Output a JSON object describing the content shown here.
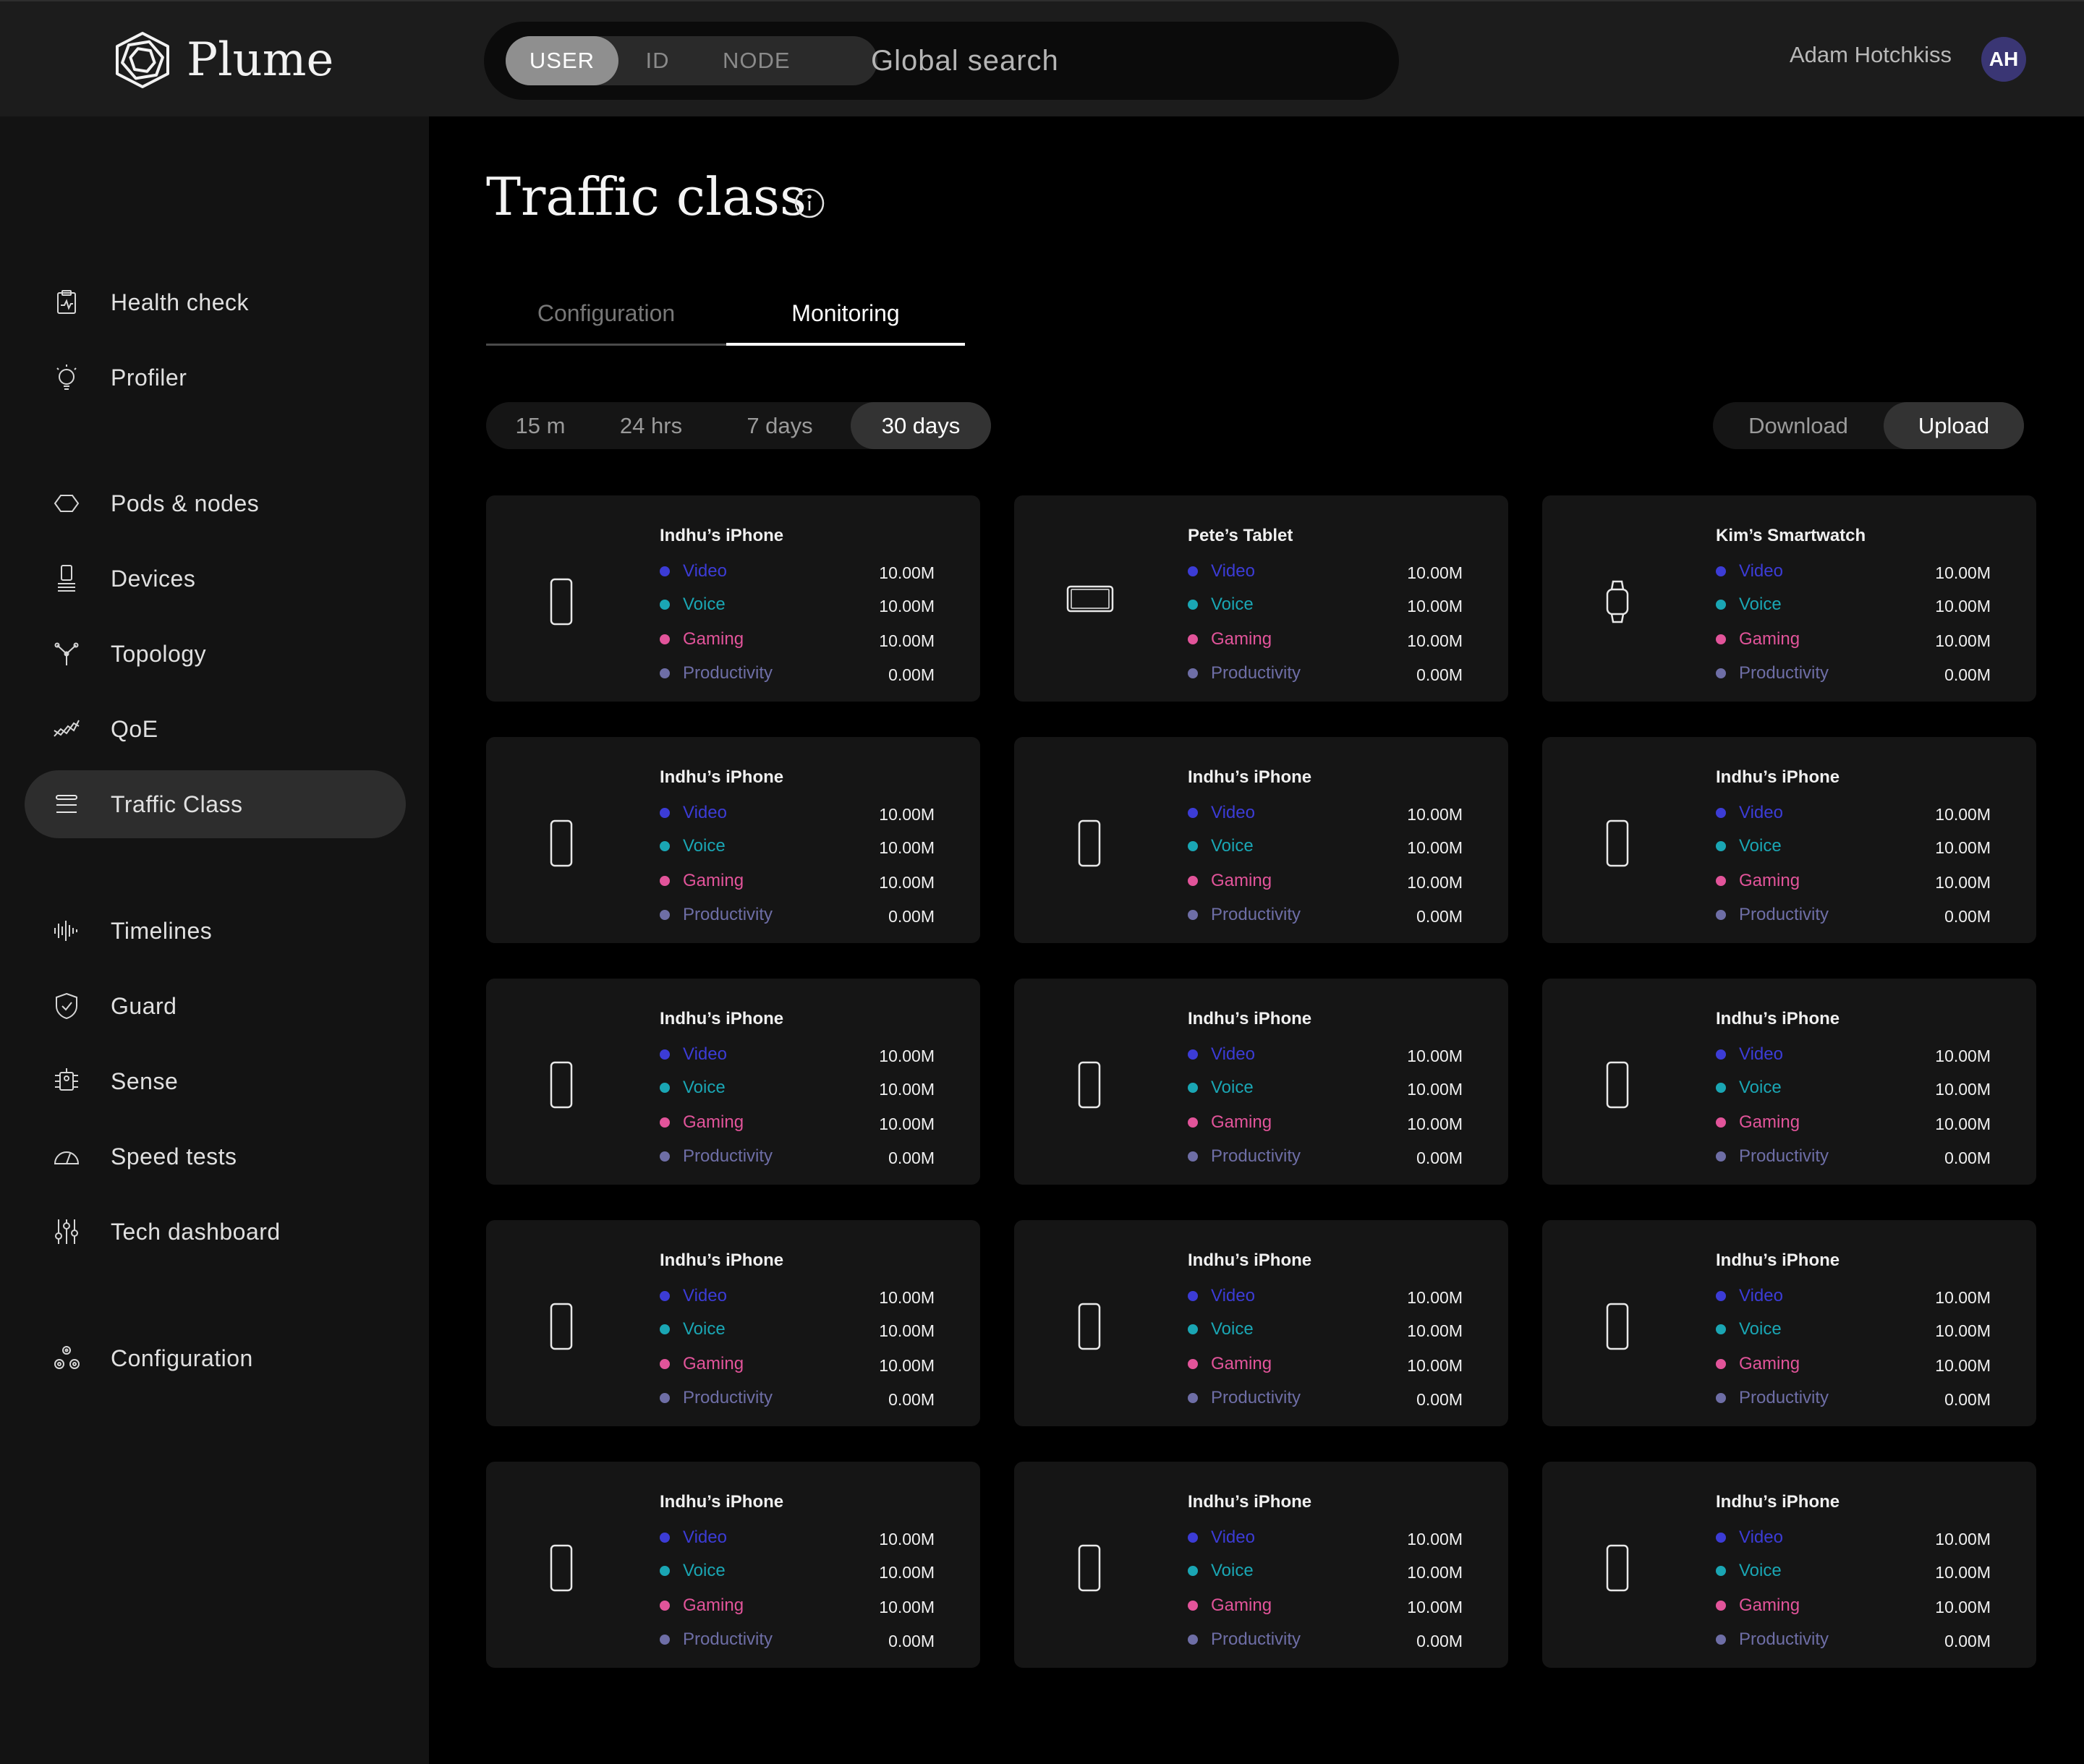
{
  "app": {
    "name": "Plume"
  },
  "search": {
    "modes": [
      "USER",
      "ID",
      "NODE"
    ],
    "active_mode": "USER",
    "placeholder": "Global search"
  },
  "user": {
    "name": "Adam Hotchkiss",
    "initials": "AH"
  },
  "sidebar": {
    "items": [
      {
        "label": "Health check",
        "icon": "clipboard-pulse-icon",
        "active": false
      },
      {
        "label": "Profiler",
        "icon": "lightbulb-icon",
        "active": false
      },
      {
        "label": "Pods & nodes",
        "icon": "hexagon-icon",
        "active": false
      },
      {
        "label": "Devices",
        "icon": "devices-icon",
        "active": false
      },
      {
        "label": "Topology",
        "icon": "topology-icon",
        "active": false
      },
      {
        "label": "QoE",
        "icon": "trend-icon",
        "active": false
      },
      {
        "label": "Traffic Class",
        "icon": "list-icon",
        "active": true
      },
      {
        "label": "Timelines",
        "icon": "waveform-icon",
        "active": false
      },
      {
        "label": "Guard",
        "icon": "shield-icon",
        "active": false
      },
      {
        "label": "Sense",
        "icon": "chip-icon",
        "active": false
      },
      {
        "label": "Speed tests",
        "icon": "speedometer-icon",
        "active": false
      },
      {
        "label": "Tech dashboard",
        "icon": "sliders-icon",
        "active": false
      },
      {
        "label": "Configuration",
        "icon": "gears-icon",
        "active": false
      }
    ]
  },
  "main": {
    "title": "Traffic class",
    "tabs": [
      {
        "label": "Configuration",
        "active": false
      },
      {
        "label": "Monitoring",
        "active": true
      }
    ],
    "time_ranges": [
      {
        "label": "15 m",
        "active": false
      },
      {
        "label": "24 hrs",
        "active": false
      },
      {
        "label": "7 days",
        "active": false
      },
      {
        "label": "30 days",
        "active": true
      }
    ],
    "directions": [
      {
        "label": "Download",
        "active": false
      },
      {
        "label": "Upload",
        "active": true
      }
    ]
  },
  "traffic_colors": {
    "Video": "#3c3cd6",
    "Voice": "#1aa6b4",
    "Gaming": "#e2549a",
    "Productivity": "#6e6ea6"
  },
  "devices": [
    {
      "name": "Indhu’s iPhone",
      "type": "phone",
      "metrics": [
        {
          "label": "Video",
          "value": "10.00M"
        },
        {
          "label": "Voice",
          "value": "10.00M"
        },
        {
          "label": "Gaming",
          "value": "10.00M"
        },
        {
          "label": "Productivity",
          "value": "0.00M"
        }
      ]
    },
    {
      "name": "Pete’s Tablet",
      "type": "tablet",
      "metrics": [
        {
          "label": "Video",
          "value": "10.00M"
        },
        {
          "label": "Voice",
          "value": "10.00M"
        },
        {
          "label": "Gaming",
          "value": "10.00M"
        },
        {
          "label": "Productivity",
          "value": "0.00M"
        }
      ]
    },
    {
      "name": "Kim’s Smartwatch",
      "type": "watch",
      "metrics": [
        {
          "label": "Video",
          "value": "10.00M"
        },
        {
          "label": "Voice",
          "value": "10.00M"
        },
        {
          "label": "Gaming",
          "value": "10.00M"
        },
        {
          "label": "Productivity",
          "value": "0.00M"
        }
      ]
    },
    {
      "name": "Indhu’s iPhone",
      "type": "phone",
      "metrics": [
        {
          "label": "Video",
          "value": "10.00M"
        },
        {
          "label": "Voice",
          "value": "10.00M"
        },
        {
          "label": "Gaming",
          "value": "10.00M"
        },
        {
          "label": "Productivity",
          "value": "0.00M"
        }
      ]
    },
    {
      "name": "Indhu’s iPhone",
      "type": "phone",
      "metrics": [
        {
          "label": "Video",
          "value": "10.00M"
        },
        {
          "label": "Voice",
          "value": "10.00M"
        },
        {
          "label": "Gaming",
          "value": "10.00M"
        },
        {
          "label": "Productivity",
          "value": "0.00M"
        }
      ]
    },
    {
      "name": "Indhu’s iPhone",
      "type": "phone",
      "metrics": [
        {
          "label": "Video",
          "value": "10.00M"
        },
        {
          "label": "Voice",
          "value": "10.00M"
        },
        {
          "label": "Gaming",
          "value": "10.00M"
        },
        {
          "label": "Productivity",
          "value": "0.00M"
        }
      ]
    },
    {
      "name": "Indhu’s iPhone",
      "type": "phone",
      "metrics": [
        {
          "label": "Video",
          "value": "10.00M"
        },
        {
          "label": "Voice",
          "value": "10.00M"
        },
        {
          "label": "Gaming",
          "value": "10.00M"
        },
        {
          "label": "Productivity",
          "value": "0.00M"
        }
      ]
    },
    {
      "name": "Indhu’s iPhone",
      "type": "phone",
      "metrics": [
        {
          "label": "Video",
          "value": "10.00M"
        },
        {
          "label": "Voice",
          "value": "10.00M"
        },
        {
          "label": "Gaming",
          "value": "10.00M"
        },
        {
          "label": "Productivity",
          "value": "0.00M"
        }
      ]
    },
    {
      "name": "Indhu’s iPhone",
      "type": "phone",
      "metrics": [
        {
          "label": "Video",
          "value": "10.00M"
        },
        {
          "label": "Voice",
          "value": "10.00M"
        },
        {
          "label": "Gaming",
          "value": "10.00M"
        },
        {
          "label": "Productivity",
          "value": "0.00M"
        }
      ]
    },
    {
      "name": "Indhu’s iPhone",
      "type": "phone",
      "metrics": [
        {
          "label": "Video",
          "value": "10.00M"
        },
        {
          "label": "Voice",
          "value": "10.00M"
        },
        {
          "label": "Gaming",
          "value": "10.00M"
        },
        {
          "label": "Productivity",
          "value": "0.00M"
        }
      ]
    },
    {
      "name": "Indhu’s iPhone",
      "type": "phone",
      "metrics": [
        {
          "label": "Video",
          "value": "10.00M"
        },
        {
          "label": "Voice",
          "value": "10.00M"
        },
        {
          "label": "Gaming",
          "value": "10.00M"
        },
        {
          "label": "Productivity",
          "value": "0.00M"
        }
      ]
    },
    {
      "name": "Indhu’s iPhone",
      "type": "phone",
      "metrics": [
        {
          "label": "Video",
          "value": "10.00M"
        },
        {
          "label": "Voice",
          "value": "10.00M"
        },
        {
          "label": "Gaming",
          "value": "10.00M"
        },
        {
          "label": "Productivity",
          "value": "0.00M"
        }
      ]
    },
    {
      "name": "Indhu’s iPhone",
      "type": "phone",
      "metrics": [
        {
          "label": "Video",
          "value": "10.00M"
        },
        {
          "label": "Voice",
          "value": "10.00M"
        },
        {
          "label": "Gaming",
          "value": "10.00M"
        },
        {
          "label": "Productivity",
          "value": "0.00M"
        }
      ]
    },
    {
      "name": "Indhu’s iPhone",
      "type": "phone",
      "metrics": [
        {
          "label": "Video",
          "value": "10.00M"
        },
        {
          "label": "Voice",
          "value": "10.00M"
        },
        {
          "label": "Gaming",
          "value": "10.00M"
        },
        {
          "label": "Productivity",
          "value": "0.00M"
        }
      ]
    },
    {
      "name": "Indhu’s iPhone",
      "type": "phone",
      "metrics": [
        {
          "label": "Video",
          "value": "10.00M"
        },
        {
          "label": "Voice",
          "value": "10.00M"
        },
        {
          "label": "Gaming",
          "value": "10.00M"
        },
        {
          "label": "Productivity",
          "value": "0.00M"
        }
      ]
    }
  ]
}
